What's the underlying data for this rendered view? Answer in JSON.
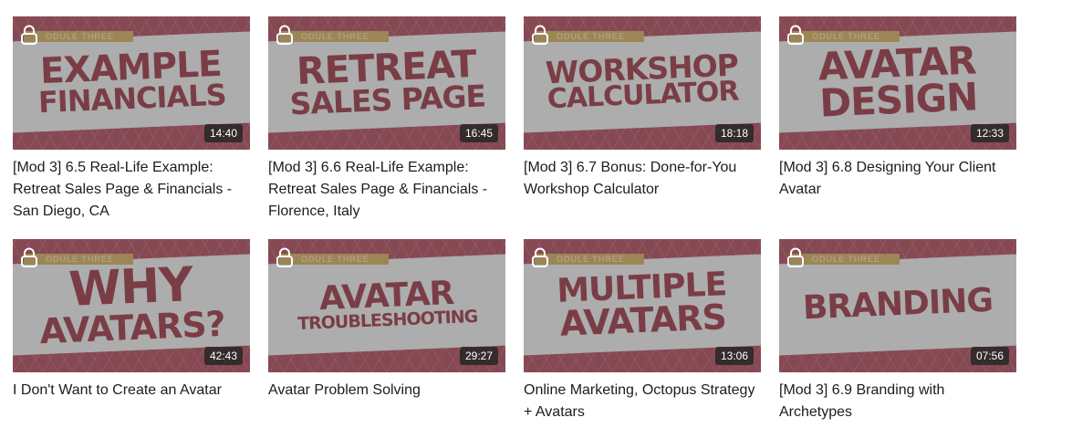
{
  "cards": [
    {
      "line1": "EXAMPLE",
      "line2": "FINANCIALS",
      "tag": "ODULE THREE",
      "duration": "14:40",
      "title": "[Mod 3] 6.5 Real-Life Example: Retreat Sales Page & Financials - San Diego, CA"
    },
    {
      "line1": "RETREAT",
      "line2": "SALES PAGE",
      "tag": "ODULE THREE",
      "duration": "16:45",
      "title": "[Mod 3] 6.6 Real-Life Example: Retreat Sales Page & Financials - Florence, Italy"
    },
    {
      "line1": "WORKSHOP",
      "line2": "CALCULATOR",
      "tag": "ODULE THREE",
      "duration": "18:18",
      "title": "[Mod 3] 6.7 Bonus: Done-for-You Workshop Calculator"
    },
    {
      "line1": "AVATAR",
      "line2": "DESIGN",
      "tag": "ODULE THREE",
      "duration": "12:33",
      "title": "[Mod 3] 6.8 Designing Your Client Avatar"
    },
    {
      "line1": "WHY",
      "line2": "AVATARS?",
      "tag": "ODULE THREE",
      "duration": "42:43",
      "title": "I Don't Want to Create an Avatar"
    },
    {
      "line1": "AVATAR",
      "line2": "TROUBLESHOOTING",
      "tag": "ODULE THREE",
      "duration": "29:27",
      "title": "Avatar Problem Solving"
    },
    {
      "line1": "MULTIPLE",
      "line2": "AVATARS",
      "tag": "ODULE THREE",
      "duration": "13:06",
      "title": "Online Marketing, Octopus Strategy + Avatars"
    },
    {
      "line1": "BRANDING",
      "line2": "",
      "tag": "ODULE THREE",
      "duration": "07:56",
      "title": "[Mod 3] 6.9 Branding with Archetypes"
    }
  ],
  "icons": {
    "lock": "lock-icon"
  },
  "colors": {
    "thumbnail_red": "#a23a4a",
    "headline": "#8e2535",
    "tag_gold": "#c9a24e"
  }
}
